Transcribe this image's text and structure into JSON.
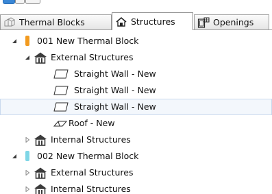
{
  "tabs": [
    {
      "label": "Thermal Blocks",
      "icon": "thermal-blocks-icon",
      "active": false
    },
    {
      "label": "Structures",
      "icon": "structures-icon",
      "active": true
    },
    {
      "label": "Openings",
      "icon": "openings-icon",
      "active": false
    }
  ],
  "tree": {
    "block1": {
      "label": "001 New Thermal Block",
      "color": "#f29a1f"
    },
    "block1_external": {
      "label": "External Structures"
    },
    "wall1": {
      "label": "Straight Wall - New"
    },
    "wall2": {
      "label": "Straight Wall - New"
    },
    "wall3": {
      "label": "Straight Wall - New"
    },
    "roof1": {
      "label": "Roof - New"
    },
    "block1_internal": {
      "label": "Internal Structures"
    },
    "block2": {
      "label": "002 New Thermal Block",
      "color": "#7fd6e6"
    },
    "block2_external": {
      "label": "External Structures"
    },
    "block2_internal": {
      "label": "Internal Structures"
    }
  },
  "colors": {
    "accent_blue": "#3a87d6",
    "selection_bg": "#f3f7fc",
    "selection_border": "#c9d9ee",
    "house_icon": "#3b3b3b"
  }
}
